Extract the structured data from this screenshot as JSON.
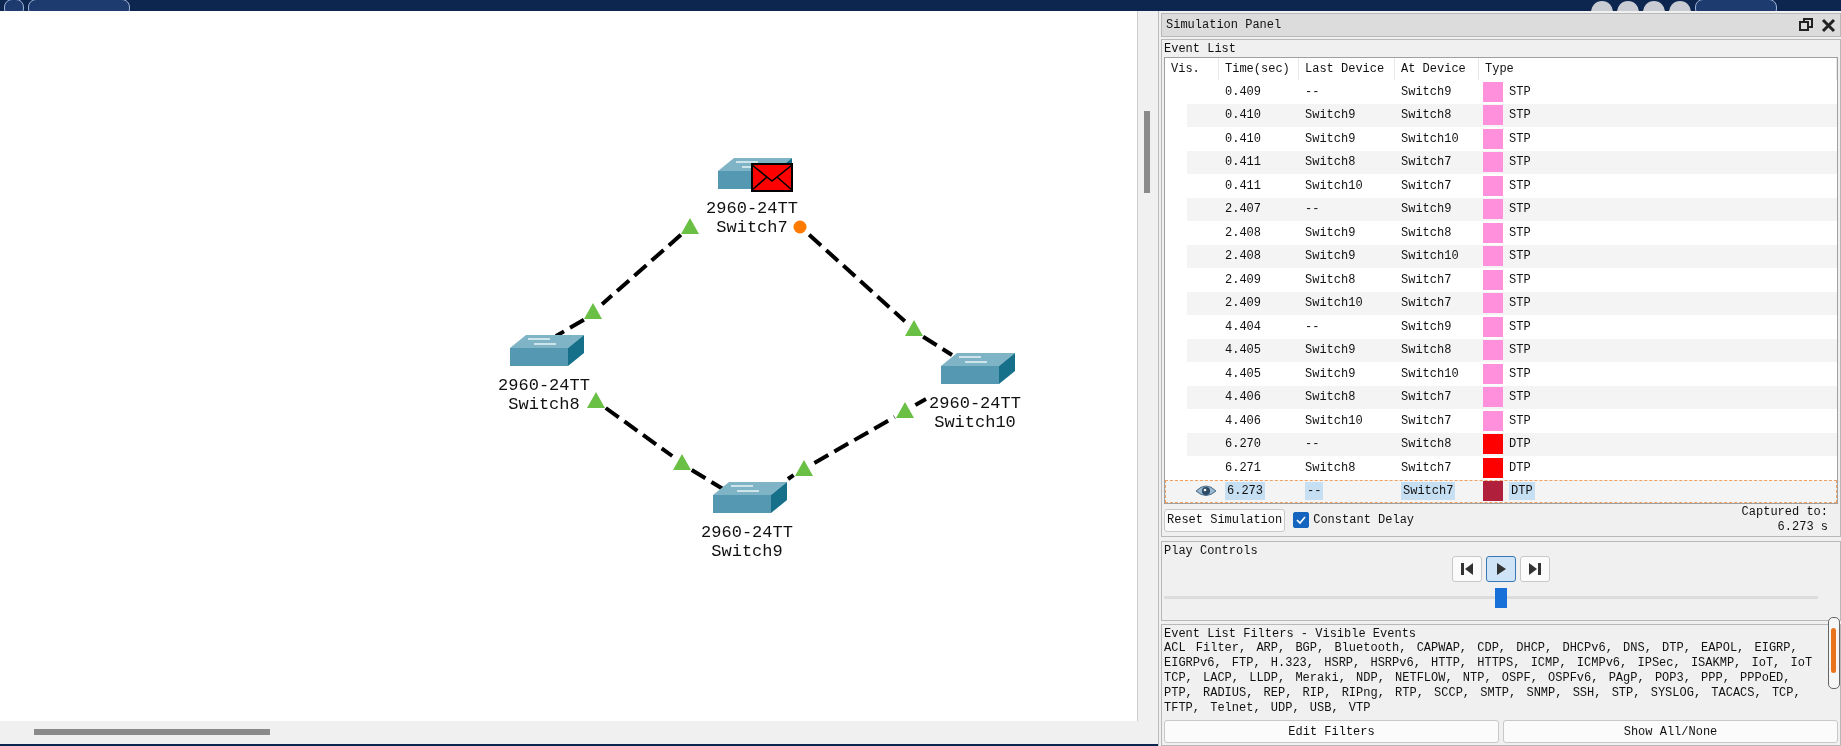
{
  "canvas": {
    "devices": [
      {
        "model": "2960-24TT",
        "name": "Switch7"
      },
      {
        "model": "2960-24TT",
        "name": "Switch8"
      },
      {
        "model": "2960-24TT",
        "name": "Switch10"
      },
      {
        "model": "2960-24TT",
        "name": "Switch9"
      }
    ],
    "links": [
      {
        "ends": [
          {
            "blocking": false
          },
          {
            "blocking": false
          }
        ]
      },
      {
        "ends": [
          {
            "blocking": true
          },
          {
            "blocking": false
          }
        ]
      },
      {
        "ends": [
          {
            "blocking": false
          },
          {
            "blocking": false
          }
        ]
      },
      {
        "ends": [
          {
            "blocking": false
          },
          {
            "blocking": false
          }
        ]
      }
    ]
  },
  "simulation_panel": {
    "title": "Simulation Panel",
    "event_list": {
      "label": "Event List",
      "columns": [
        "Vis.",
        "Time(sec)",
        "Last Device",
        "At Device",
        "Type"
      ],
      "rows": [
        {
          "time": "0.409",
          "last_device": "--",
          "at_device": "Switch9",
          "type": "STP",
          "color": "#ff91dc",
          "selected": false
        },
        {
          "time": "0.410",
          "last_device": "Switch9",
          "at_device": "Switch8",
          "type": "STP",
          "color": "#ff91dc",
          "selected": false
        },
        {
          "time": "0.410",
          "last_device": "Switch9",
          "at_device": "Switch10",
          "type": "STP",
          "color": "#ff91dc",
          "selected": false
        },
        {
          "time": "0.411",
          "last_device": "Switch8",
          "at_device": "Switch7",
          "type": "STP",
          "color": "#ff91dc",
          "selected": false
        },
        {
          "time": "0.411",
          "last_device": "Switch10",
          "at_device": "Switch7",
          "type": "STP",
          "color": "#ff91dc",
          "selected": false
        },
        {
          "time": "2.407",
          "last_device": "--",
          "at_device": "Switch9",
          "type": "STP",
          "color": "#ff91dc",
          "selected": false
        },
        {
          "time": "2.408",
          "last_device": "Switch9",
          "at_device": "Switch8",
          "type": "STP",
          "color": "#ff91dc",
          "selected": false
        },
        {
          "time": "2.408",
          "last_device": "Switch9",
          "at_device": "Switch10",
          "type": "STP",
          "color": "#ff91dc",
          "selected": false
        },
        {
          "time": "2.409",
          "last_device": "Switch8",
          "at_device": "Switch7",
          "type": "STP",
          "color": "#ff91dc",
          "selected": false
        },
        {
          "time": "2.409",
          "last_device": "Switch10",
          "at_device": "Switch7",
          "type": "STP",
          "color": "#ff91dc",
          "selected": false
        },
        {
          "time": "4.404",
          "last_device": "--",
          "at_device": "Switch9",
          "type": "STP",
          "color": "#ff91dc",
          "selected": false
        },
        {
          "time": "4.405",
          "last_device": "Switch9",
          "at_device": "Switch8",
          "type": "STP",
          "color": "#ff91dc",
          "selected": false
        },
        {
          "time": "4.405",
          "last_device": "Switch9",
          "at_device": "Switch10",
          "type": "STP",
          "color": "#ff91dc",
          "selected": false
        },
        {
          "time": "4.406",
          "last_device": "Switch8",
          "at_device": "Switch7",
          "type": "STP",
          "color": "#ff91dc",
          "selected": false
        },
        {
          "time": "4.406",
          "last_device": "Switch10",
          "at_device": "Switch7",
          "type": "STP",
          "color": "#ff91dc",
          "selected": false
        },
        {
          "time": "6.270",
          "last_device": "--",
          "at_device": "Switch8",
          "type": "DTP",
          "color": "#ff0000",
          "selected": false
        },
        {
          "time": "6.271",
          "last_device": "Switch8",
          "at_device": "Switch7",
          "type": "DTP",
          "color": "#ff0000",
          "selected": false
        },
        {
          "time": "6.273",
          "last_device": "--",
          "at_device": "Switch7",
          "type": "DTP",
          "color": "#b0203c",
          "selected": true
        }
      ]
    },
    "reset_button": "Reset Simulation",
    "constant_delay": {
      "label": "Constant Delay",
      "checked": true
    },
    "captured": {
      "label": "Captured to:",
      "value": "6.273 s"
    },
    "play_controls": {
      "label": "Play Controls",
      "buttons": [
        {
          "kind": "back",
          "selected": false
        },
        {
          "kind": "play",
          "selected": true
        },
        {
          "kind": "forward",
          "selected": false
        }
      ],
      "level": 0.5
    },
    "filters": {
      "label": "Event List Filters - Visible Events",
      "text": "ACL Filter, ARP, BGP, Bluetooth, CAPWAP, CDP, DHCP, DHCPv6, DNS, DTP, EAPOL, EIGRP, EIGRPv6, FTP, H.323, HSRP, HSRPv6, HTTP, HTTPS, ICMP, ICMPv6, IPSec, ISAKMP, IoT, IoT TCP, LACP, LLDP, Meraki, NDP, NETFLOW, NTP, OSPF, OSPFv6, PAgP, POP3, PPP, PPPoED, PTP, RADIUS, REP, RIP, RIPng, RTP, SCCP, SMTP, SNMP, SSH, STP, SYSLOG, TACACS, TCP, TFTP, Telnet, UDP, USB, VTP",
      "buttons": [
        "Edit Filters",
        "Show All/None"
      ]
    }
  }
}
